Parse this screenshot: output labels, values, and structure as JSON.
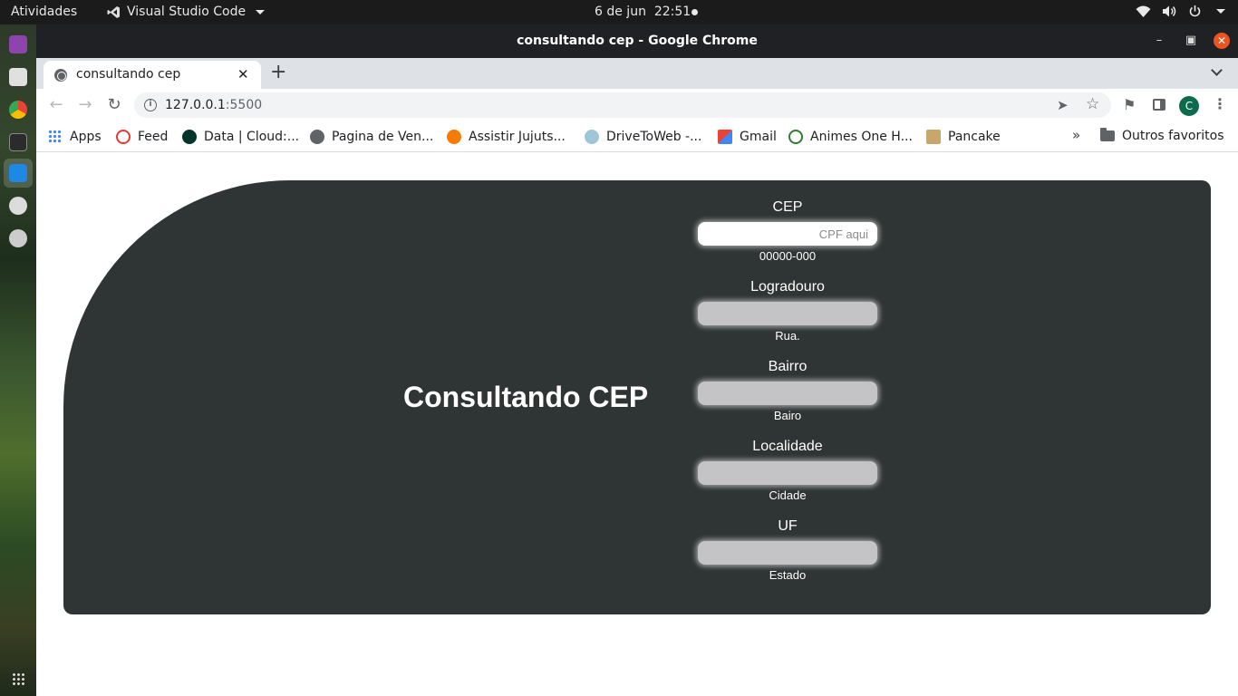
{
  "topbar": {
    "activities": "Atividades",
    "app_menu": "Visual Studio Code",
    "date": "6 de jun",
    "time": "22:51"
  },
  "window": {
    "title": "consultando cep - Google Chrome"
  },
  "tab": {
    "title": "consultando cep"
  },
  "address_bar": {
    "host": "127.0.0.1",
    "port": ":5500"
  },
  "profile": {
    "initial": "C"
  },
  "bookmarks": {
    "items": [
      {
        "label": "Apps",
        "icon": "apps-grid-icon"
      },
      {
        "label": "Feed",
        "icon": "feed-icon"
      },
      {
        "label": "Data | Cloud:...",
        "icon": "mongodb-leaf-icon"
      },
      {
        "label": "Pagina de Ven...",
        "icon": "globe-icon"
      },
      {
        "label": "Assistir Jujuts...",
        "icon": "stats-icon"
      },
      {
        "label": "DriveToWeb -...",
        "icon": "cloud-icon"
      },
      {
        "label": "Gmail",
        "icon": "gmail-icon"
      },
      {
        "label": "Animes One H...",
        "icon": "anime-icon"
      },
      {
        "label": "Pancake",
        "icon": "pancake-icon"
      }
    ],
    "more": "»",
    "other": "Outros favoritos"
  },
  "page": {
    "heading": "Consultando CEP",
    "fields": [
      {
        "label": "CEP",
        "placeholder": "CPF aqui",
        "value": "",
        "hint": "00000-000"
      },
      {
        "label": "Logradouro",
        "placeholder": "",
        "value": "",
        "hint": "Rua."
      },
      {
        "label": "Bairro",
        "placeholder": "",
        "value": "",
        "hint": "Bairo"
      },
      {
        "label": "Localidade",
        "placeholder": "",
        "value": "",
        "hint": "Cidade"
      },
      {
        "label": "UF",
        "placeholder": "",
        "value": "",
        "hint": "Estado"
      }
    ]
  },
  "colors": {
    "card_bg": "#2f3534",
    "input_bg": "#c4c4c6",
    "ubuntu_close": "#e95420",
    "profile_bg": "#0b6b4a"
  }
}
